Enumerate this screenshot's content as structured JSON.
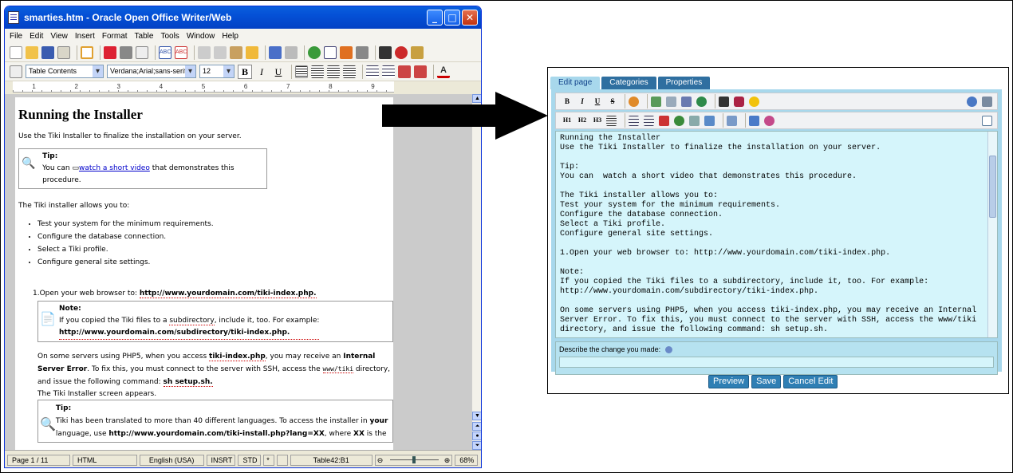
{
  "writer": {
    "title": "smarties.htm - Oracle Open Office Writer/Web",
    "menu": [
      "File",
      "Edit",
      "View",
      "Insert",
      "Format",
      "Table",
      "Tools",
      "Window",
      "Help"
    ],
    "style_select": "Table Contents",
    "font_select": "Verdana;Arial;sans-serif",
    "size_select": "12",
    "bold_glyph": "B",
    "italic_glyph": "I",
    "underline_glyph": "U",
    "ruler_marks": [
      "1",
      "2",
      "3",
      "4",
      "5",
      "6",
      "7",
      "8",
      "9"
    ],
    "doc": {
      "heading": "Running the Installer",
      "intro": "Use the Tiki Installer to finalize the installation on your server.",
      "tip_label": "Tip:",
      "tip_prefix": "You can ",
      "tip_link": "watch a short video",
      "tip_suffix": " that demonstrates this procedure.",
      "allows": "The Tiki installer allows you to:",
      "bullets": [
        "Test your system for the minimum requirements.",
        "Configure the database connection.",
        "Select a Tiki profile.",
        "Configure general site settings."
      ],
      "step1_prefix": "1.Open your web browser to: ",
      "step1_url": "http://www.yourdomain.com/tiki-index.php.",
      "note_label": "Note:",
      "note_prefix": "If you copied the Tiki files to a ",
      "note_word": "subdirectory",
      "note_suffix": ", include it, too. For example:",
      "note_url": "http://www.yourdomain.com/subdirectory/tiki-index.php.",
      "php5_1": "On some servers using PHP5, when you access ",
      "php5_file": "tiki-index.php",
      "php5_2": ", you may receive an ",
      "php5_err": "Internal Server Error",
      "php5_3": ". To fix this, you must connect to the server with SSH, access the ",
      "php5_dir": "www/tiki",
      "php5_4": " directory, and issue the following command: ",
      "php5_cmd": "sh setup.sh.",
      "screen_appears": "The Tiki Installer screen appears.",
      "tip2_label": "Tip:",
      "tip2_1": "Tiki has been translated to more than 40 different languages. To access the installer in ",
      "tip2_your": "your",
      "tip2_2": " language, use ",
      "tip2_url": "http://www.yourdomain.com/tiki-install.php?lang=XX",
      "tip2_3": ", where ",
      "tip2_xx": "XX",
      "tip2_4": " is the"
    },
    "status": {
      "page": "Page 1 / 11",
      "mode": "HTML",
      "lang": "English (USA)",
      "insert": "INSRT",
      "std": "STD",
      "star": "*",
      "cell": "Table42:B1",
      "zoom": "68%"
    }
  },
  "tiki": {
    "tabs": [
      "Edit page",
      "Categories",
      "Properties"
    ],
    "toolbar1": [
      "B",
      "I",
      "U",
      "S"
    ],
    "toolbar2": [
      "H1",
      "H2",
      "H3"
    ],
    "content": "Running the Installer\nUse the Tiki Installer to finalize the installation on your server.\n\nTip:\nYou can  watch a short video that demonstrates this procedure.\n\nThe Tiki installer allows you to:\nTest your system for the minimum requirements.\nConfigure the database connection.\nSelect a Tiki profile.\nConfigure general site settings.\n\n1.Open your web browser to: http://www.yourdomain.com/tiki-index.php.\n\nNote:\nIf you copied the Tiki files to a subdirectory, include it, too. For example:\nhttp://www.yourdomain.com/subdirectory/tiki-index.php.\n\nOn some servers using PHP5, when you access tiki-index.php, you may receive an Internal\nServer Error. To fix this, you must connect to the server with SSH, access the www/tiki\ndirectory, and issue the following command: sh setup.sh.",
    "describe_label": "Describe the change you made:",
    "buttons": {
      "preview": "Preview",
      "save": "Save",
      "cancel": "Cancel Edit"
    }
  }
}
